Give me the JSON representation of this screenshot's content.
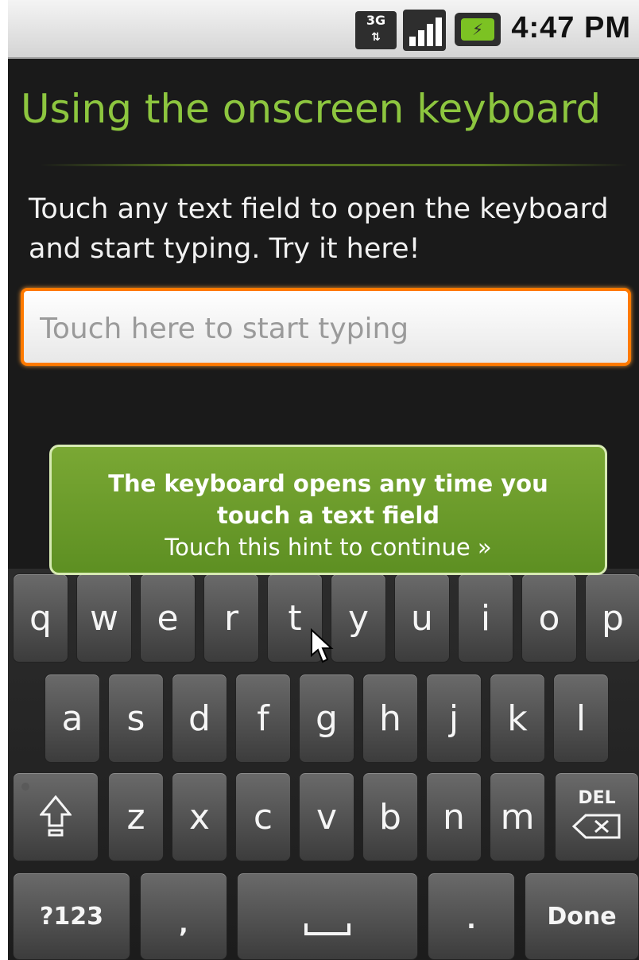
{
  "status_bar": {
    "network_label": "3G",
    "time": "4:47 PM",
    "icons": [
      "network-3g-icon",
      "signal-strength-icon",
      "battery-charging-icon"
    ],
    "colors": {
      "battery": "#7cc223"
    }
  },
  "page": {
    "title": "Using the onscreen keyboard",
    "instructions": "Touch any text field to open the keyboard and start typing. Try it here!",
    "text_field": {
      "placeholder": "Touch here to start typing",
      "value": ""
    },
    "colors": {
      "title": "#8dc63f",
      "field_focus": "#ff7a00"
    }
  },
  "hint": {
    "main": "The keyboard opens any time you touch a text field",
    "sub": "Touch this hint to continue »",
    "color": "#6e9c2c"
  },
  "keyboard": {
    "row1": [
      "q",
      "w",
      "e",
      "r",
      "t",
      "y",
      "u",
      "i",
      "o",
      "p"
    ],
    "row2": [
      "a",
      "s",
      "d",
      "f",
      "g",
      "h",
      "j",
      "k",
      "l"
    ],
    "row3": [
      "z",
      "x",
      "c",
      "v",
      "b",
      "n",
      "m"
    ],
    "shift_icon": "shift-arrow-icon",
    "delete_label": "DEL",
    "delete_icon": "backspace-icon",
    "symbols_label": "?123",
    "comma_label": ",",
    "space_icon": "space-bar-icon",
    "period_label": ".",
    "done_label": "Done"
  }
}
